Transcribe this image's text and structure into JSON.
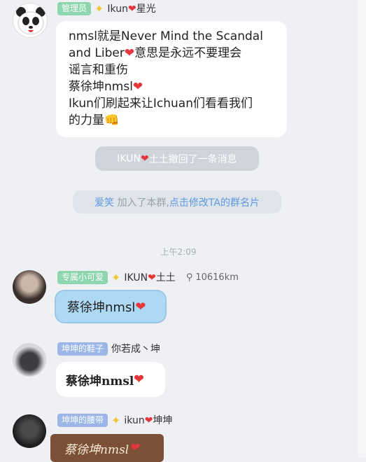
{
  "messages": [
    {
      "role_tag": "管理员",
      "name_pre": "Ikun",
      "name_post": "星光",
      "lines": [
        {
          "text": "nmsl就是Never Mind the Scandal"
        },
        {
          "pre": "and Liber",
          "post": "意思是永远不要理会"
        },
        {
          "text": "谣言和重伤"
        },
        {
          "pre": "蔡徐坤nmsl",
          "post": ""
        },
        {
          "text": "Ikun们刷起来让Ichuan们看看我们"
        },
        {
          "pre": "的力量",
          "emoji": "👊"
        }
      ]
    },
    {
      "role_tag": "专属小可爱",
      "name_pre": "IKUN",
      "name_post": "土土",
      "location": "10616km",
      "text": "蔡徐坤nmsl"
    },
    {
      "role_tag": "坤坤的鞋子",
      "name": "你若成丶坤",
      "text": "蔡徐坤nmsl"
    },
    {
      "role_tag": "坤坤的腰带",
      "name_pre": "ikun",
      "name_post": "坤坤",
      "text": "蔡徐坤nmsl"
    }
  ],
  "system": {
    "recall_pre": "IKUN",
    "recall_post": "土土撤回了一条消息",
    "join_name": "爱笑",
    "join_mid": "加入了本群,",
    "join_link": "点击修改TA的群名片",
    "time": "上午2:09"
  }
}
